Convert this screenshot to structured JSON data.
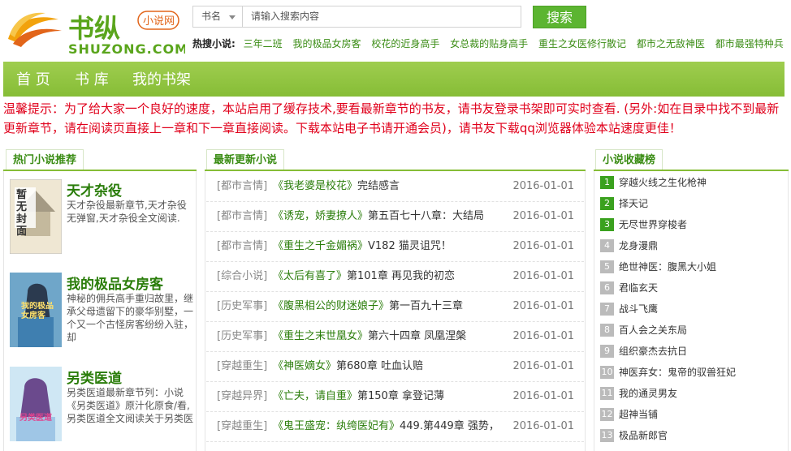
{
  "logo": {
    "main_text": "书纵",
    "tag_text": "小说网",
    "sub_text": "SHUZONG.COM"
  },
  "search": {
    "select_value": "书名",
    "placeholder": "请输入搜索内容",
    "button_label": "搜索"
  },
  "hot_search": {
    "label": "热搜小说:",
    "items": [
      "三年二班",
      "我的极品女房客",
      "校花的近身高手",
      "女总裁的贴身高手",
      "重生之女医修行散记",
      "都市之无敌神医",
      "都市最强特种兵"
    ]
  },
  "nav": {
    "items": [
      "首 页",
      "书 库",
      "我的书架"
    ]
  },
  "notice": "温馨提示：为了给大家一个良好的速度，本站启用了缓存技术,要看最新章节的书友，请书友登录书架即可实时查看. (另外:如在目录中找不到最新更新章节，请在阅读页直接上一章和下一章直接阅读。下载本站电子书请开通会员)，请书友下载qq浏览器体验本站速度更佳！",
  "left_panel": {
    "title": "热门小说推荐",
    "books": [
      {
        "title": "天才杂役",
        "desc": "天才杂役最新章节,天才杂役无弹窗,天才杂役全文阅读.",
        "cover_text": "暂无封面"
      },
      {
        "title": "我的极品女房客",
        "desc": "神秘的佣兵高手重归故里，继承父母遗留下的豪华别墅，一个又一个古怪房客纷纷入驻，却",
        "cover_text": "我的极品女房客"
      },
      {
        "title": "另类医道",
        "desc": "另类医道最新章节列：小说《另类医道》原汁化原食/看,另类医道全文阅读关于另类医",
        "cover_text": "另类医道"
      }
    ]
  },
  "mid_panel": {
    "title": "最新更新小说",
    "rows": [
      {
        "cat": "[都市言情]",
        "book": "《我老婆是校花》",
        "chapter": "完结感言",
        "date": "2016-01-01"
      },
      {
        "cat": "[都市言情]",
        "book": "《诱宠，娇妻撩人》",
        "chapter": "第五百七十八章：大结局",
        "date": "2016-01-01"
      },
      {
        "cat": "[都市言情]",
        "book": "《重生之千金媚祸》",
        "chapter": "V182 猫灵诅咒！",
        "date": "2016-01-01"
      },
      {
        "cat": "[综合小说]",
        "book": "《太后有喜了》",
        "chapter": "第101章 再见我的初恋",
        "date": "2016-01-01"
      },
      {
        "cat": "[历史军事]",
        "book": "《腹黑相公的财迷娘子》",
        "chapter": "第一百九十三章",
        "date": "2016-01-01"
      },
      {
        "cat": "[历史军事]",
        "book": "《重生之末世凰女》",
        "chapter": "第六十四章 凤凰涅槃",
        "date": "2016-01-01"
      },
      {
        "cat": "[穿越重生]",
        "book": "《神医嫡女》",
        "chapter": "第680章 吐血认赔",
        "date": "2016-01-01"
      },
      {
        "cat": "[穿越异界]",
        "book": "《亡夫，请自重》",
        "chapter": "第150章 拿登记薄",
        "date": "2016-01-01"
      },
      {
        "cat": "[穿越重生]",
        "book": "《鬼王盛宠：纨绔医妃有》",
        "chapter": "449.第449章 强势，",
        "date": "2016-01-01"
      }
    ]
  },
  "right_panel": {
    "title": "小说收藏榜",
    "items": [
      {
        "num": "1",
        "name": "穿越火线之生化枪神"
      },
      {
        "num": "2",
        "name": "择天记"
      },
      {
        "num": "3",
        "name": "无尽世界穿梭者"
      },
      {
        "num": "4",
        "name": "龙身漫鼎"
      },
      {
        "num": "5",
        "name": "绝世神医：腹黑大小姐"
      },
      {
        "num": "6",
        "name": "君临玄天"
      },
      {
        "num": "7",
        "name": "战斗飞鹰"
      },
      {
        "num": "8",
        "name": "百人会之关东局"
      },
      {
        "num": "9",
        "name": "组织豪杰去抗日"
      },
      {
        "num": "10",
        "name": "神医弃女：鬼帝的驭兽狂妃"
      },
      {
        "num": "11",
        "name": "我的通灵男友"
      },
      {
        "num": "12",
        "name": "超神当铺"
      },
      {
        "num": "13",
        "name": "极品新郎官"
      }
    ]
  },
  "colors": {
    "accent": "#86bd36",
    "link_green": "#2a7d0a",
    "notice_red": "#e0001b",
    "rank_top": "#3aa11e"
  }
}
